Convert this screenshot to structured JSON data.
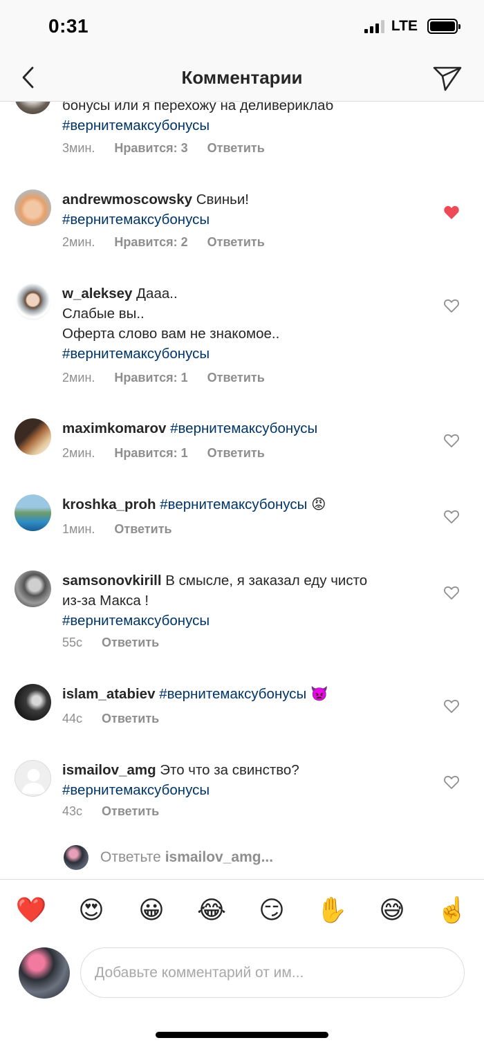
{
  "status_bar": {
    "time": "0:31",
    "network": "LTE"
  },
  "header": {
    "title": "Комментарии"
  },
  "comments": [
    {
      "username": "",
      "text": "бонусы или я перехожу на деливериклаб",
      "lines": [],
      "hashtag": "#вернитемаксубонусы",
      "time": "3мин.",
      "likes": "Нравится: 3",
      "reply": "Ответить",
      "liked": true
    },
    {
      "username": "andrewmoscowsky",
      "text": "Свиньи!",
      "lines": [],
      "hashtag": "#вернитемаксубонусы",
      "time": "2мин.",
      "likes": "Нравится: 2",
      "reply": "Ответить",
      "liked": true
    },
    {
      "username": "w_aleksey",
      "text": "Дааа..",
      "lines": [
        "Слабые вы..",
        "Оферта слово вам не знакомое.."
      ],
      "hashtag": "#вернитемаксубонусы",
      "time": "2мин.",
      "likes": "Нравится: 1",
      "reply": "Ответить",
      "liked": false
    },
    {
      "username": "maximkomarov",
      "text": "",
      "lines": [],
      "hashtag": "#вернитемаксубонусы",
      "time": "2мин.",
      "likes": "Нравится: 1",
      "reply": "Ответить",
      "liked": false
    },
    {
      "username": "kroshka_proh",
      "text": "",
      "lines": [],
      "hashtag": "#вернитемаксубонусы",
      "emoji": "😡",
      "time": "1мин.",
      "likes": "",
      "reply": "Ответить",
      "liked": false
    },
    {
      "username": "samsonovkirill",
      "text": "В смысле, я заказал еду чисто",
      "lines": [
        "из-за Макса !"
      ],
      "hashtag": "#вернитемаксубонусы",
      "time": "55с",
      "likes": "",
      "reply": "Ответить",
      "liked": false
    },
    {
      "username": "islam_atabiev",
      "text": "",
      "lines": [],
      "hashtag": "#вернитемаксубонусы",
      "emoji": "👿",
      "time": "44с",
      "likes": "",
      "reply": "Ответить",
      "liked": false
    },
    {
      "username": "ismailov_amg",
      "text": "Это что за свинство?",
      "lines": [],
      "hashtag": "#вернитемаксубонусы",
      "time": "43с",
      "likes": "",
      "reply": "Ответить",
      "liked": false
    }
  ],
  "reply_prompt": {
    "prefix": "Ответьте",
    "username": "ismailov_amg..."
  },
  "emoji_bar": [
    "❤️",
    "😍",
    "😀",
    "😂",
    "😏",
    "✋",
    "😅",
    "☝️"
  ],
  "composer": {
    "placeholder": "Добавьте комментарий от им..."
  },
  "colors": {
    "hashtag": "#003569",
    "like_active": "#ed4956",
    "meta": "#8e8e8e"
  }
}
